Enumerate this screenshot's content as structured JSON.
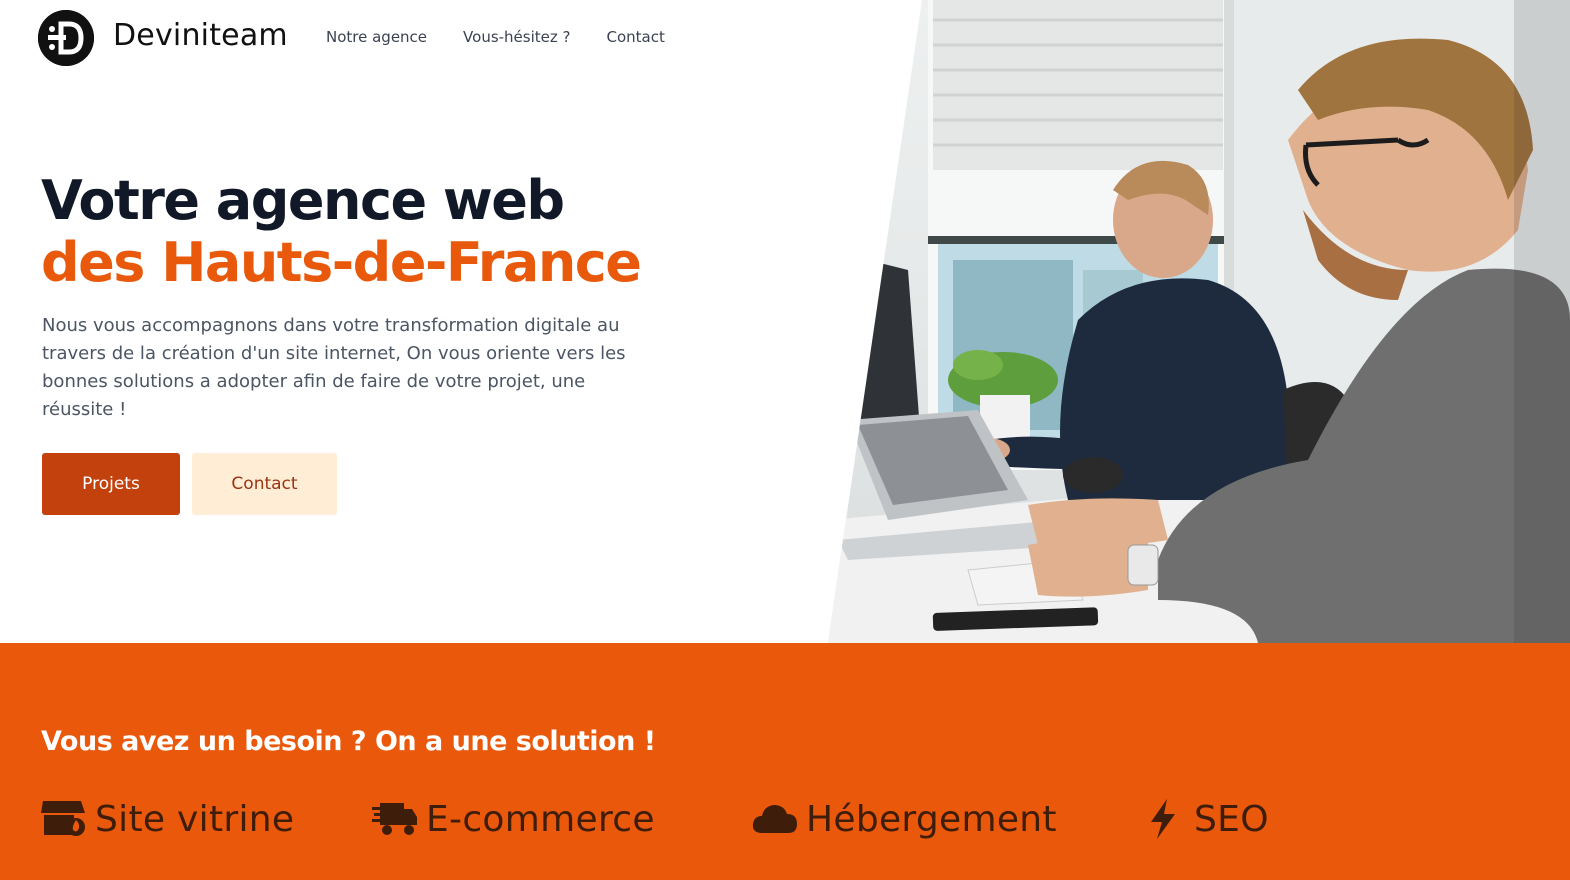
{
  "brand": {
    "name": "Deviniteam",
    "logo_icon": "deviniteam-logo-icon"
  },
  "nav": {
    "items": [
      "Notre agence",
      "Vous-hésitez ?",
      "Contact"
    ]
  },
  "hero": {
    "headline_part1": "Votre agence web ",
    "headline_highlight": "des Hauts-de-France",
    "description": "Nous vous accompagnons dans votre transformation digitale au travers de la création d'un site internet, On vous oriente vers les bonnes solutions a adopter afin de faire de votre projet, une réussite !",
    "primary_button": "Projets",
    "secondary_button": "Contact",
    "image_alt": "office-workers-photo"
  },
  "services": {
    "title": "Vous avez un besoin ? On a une solution !",
    "items": [
      {
        "label": "Site vitrine",
        "icon": "storefront-icon"
      },
      {
        "label": "E-commerce",
        "icon": "truck-fast-icon"
      },
      {
        "label": "Hébergement",
        "icon": "cloud-icon"
      },
      {
        "label": "SEO",
        "icon": "bolt-icon"
      }
    ]
  },
  "colors": {
    "accent": "#e8590c",
    "primary_button_bg": "#c2410c",
    "secondary_button_bg": "#ffedd5",
    "services_bg": "#ea580c",
    "heading_dark": "#111827"
  }
}
